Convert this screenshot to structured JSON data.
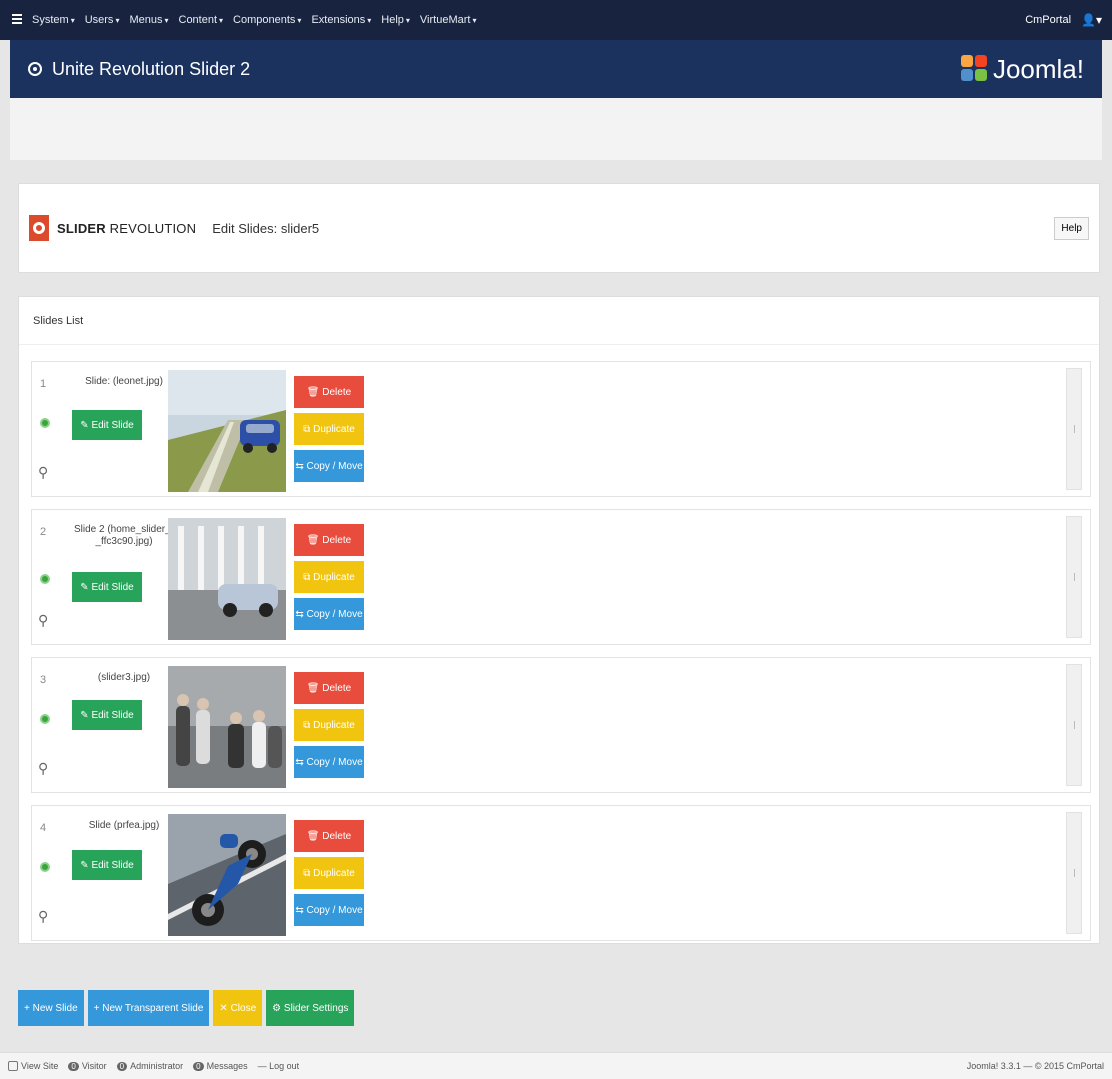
{
  "topbar": {
    "menu": [
      "System",
      "Users",
      "Menus",
      "Content",
      "Components",
      "Extensions",
      "Help",
      "VirtueMart"
    ],
    "site_name": "CmPortal",
    "user_icon": "user-icon"
  },
  "titlebar": {
    "title": "Unite Revolution Slider 2",
    "brand": "Joomla!"
  },
  "header": {
    "logo_bold": "SLIDER",
    "logo_light": " REVOLUTION",
    "edit_title": "Edit Slides: slider5",
    "help_label": "Help"
  },
  "list": {
    "heading": "Slides List",
    "slides": [
      {
        "num": "1",
        "name": "Slide: (leonet.jpg)",
        "edit": "✎ Edit Slide",
        "delete": "🗑 Delete",
        "duplicate": "⧉ Duplicate",
        "copy": "⇆ Copy / Move"
      },
      {
        "num": "2",
        "name": "Slide 2 (home_slider_-_ffc3c90.jpg)",
        "edit": "✎ Edit Slide",
        "delete": "🗑 Delete",
        "duplicate": "⧉ Duplicate",
        "copy": "⇆ Copy / Move"
      },
      {
        "num": "3",
        "name": "(slider3.jpg)",
        "edit": "✎ Edit Slide",
        "delete": "🗑 Delete",
        "duplicate": "⧉ Duplicate",
        "copy": "⇆ Copy / Move"
      },
      {
        "num": "4",
        "name": "Slide (prfea.jpg)",
        "edit": "✎ Edit Slide",
        "delete": "🗑 Delete",
        "duplicate": "⧉ Duplicate",
        "copy": "⇆ Copy / Move"
      }
    ]
  },
  "bottom": {
    "new_slide": "+ New Slide",
    "new_transparent": "+ New Transparent Slide",
    "close": "✕ Close",
    "slider_settings": "⚙ Slider Settings"
  },
  "status": {
    "view_site": "View Site",
    "visitors_count": "0",
    "visitors": "Visitor",
    "admins_count": "0",
    "admins": "Administrator",
    "messages_count": "0",
    "messages": "Messages",
    "logout": "— Log out",
    "copyright": "Joomla! 3.3.1 — © 2015 CmPortal"
  },
  "colors": {
    "navbar": "#17233f",
    "titlebar": "#1b325e",
    "red": "#e74c3c",
    "yellow": "#f1c40f",
    "blue": "#3498db",
    "green": "#27a35a"
  }
}
